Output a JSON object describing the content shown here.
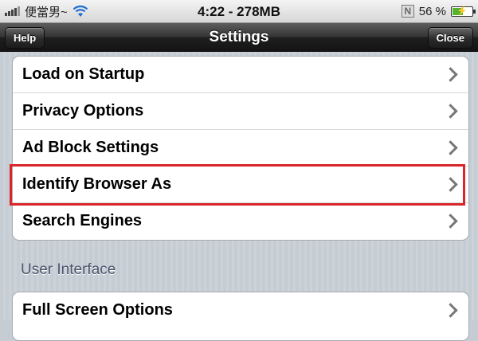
{
  "status_bar": {
    "carrier": "便當男~",
    "time": "4:22 - 278MB",
    "battery_percent": "56 %",
    "battery_level": 0.56,
    "app_badge": "N"
  },
  "nav": {
    "title": "Settings",
    "left_button": "Help",
    "right_button": "Close"
  },
  "settings_group": [
    {
      "label": "Load on Startup"
    },
    {
      "label": "Privacy Options"
    },
    {
      "label": "Ad Block Settings"
    },
    {
      "label": "Identify Browser As"
    },
    {
      "label": "Search Engines"
    }
  ],
  "user_interface": {
    "header": "User Interface",
    "items": [
      {
        "label": "Full Screen Options"
      }
    ]
  },
  "colors": {
    "highlight": "#d8262b",
    "background": "#c5ccd4"
  }
}
